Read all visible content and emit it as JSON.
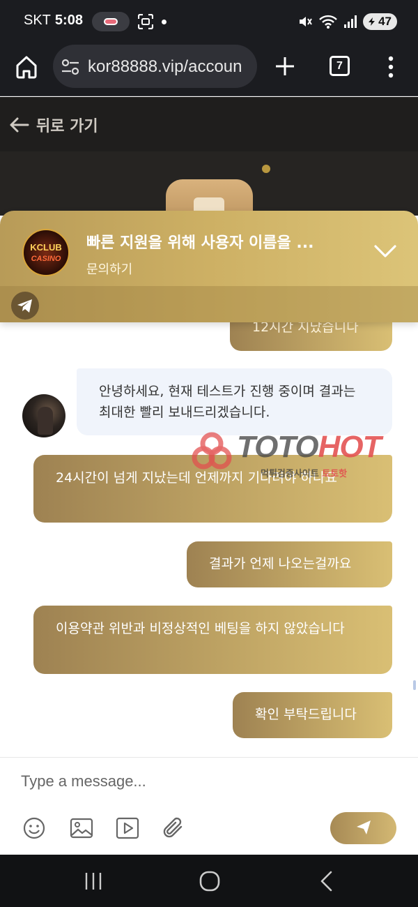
{
  "status": {
    "carrier": "SKT",
    "time": "5:08",
    "battery": "47"
  },
  "browser": {
    "url": "kor88888.vip/accoun",
    "tab_count": "7"
  },
  "page": {
    "back_label": "뒤로 가기"
  },
  "notification": {
    "title": "빠른 지원을 위해 사용자 이름을 ...",
    "subtitle": "문의하기",
    "logo_text_top": "KCLUB",
    "logo_text_bottom": "CASINO"
  },
  "messages": [
    {
      "dir": "out",
      "text": "12시간 지났습니다"
    },
    {
      "dir": "in",
      "text": "안녕하세요, 현재 테스트가 진행 중이며 결과는 최대한 빨리 보내드리겠습니다."
    },
    {
      "dir": "out",
      "text": "24시간이 넘게 지났는데 언제까지 기다려야 하나요"
    },
    {
      "dir": "out",
      "text": "결과가 언제 나오는걸까요"
    },
    {
      "dir": "out",
      "text": "이용약관 위반과 비정상적인 베팅을 하지 않았습니다"
    },
    {
      "dir": "out",
      "text": "확인 부탁드립니다"
    }
  ],
  "watermark": {
    "brand_a": "TOTO",
    "brand_b": "HOT",
    "sub_a": "먹튀검증사이트",
    "sub_b": "토토핫"
  },
  "composer": {
    "placeholder": "Type a message..."
  },
  "colors": {
    "gold_start": "#9e8252",
    "gold_end": "#d9bf74",
    "incoming_bg": "#f0f4fb",
    "dark_header": "#1f1e1d"
  }
}
